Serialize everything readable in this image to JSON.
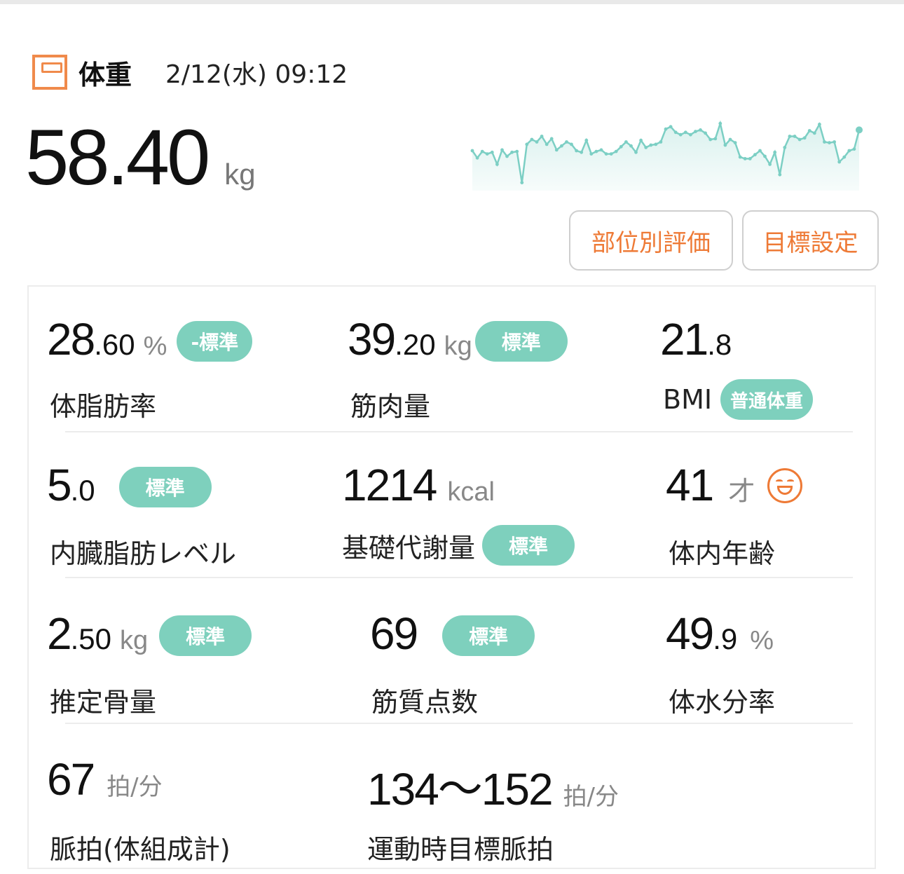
{
  "header": {
    "title": "体重",
    "datetime": "2/12(水) 09:12"
  },
  "weight": {
    "value_int": "58",
    "value_dec": ".40",
    "unit": "kg"
  },
  "sparkline": [
    50,
    41,
    49,
    46,
    48,
    33,
    51,
    43,
    48,
    49,
    10,
    58,
    64,
    61,
    68,
    58,
    65,
    51,
    56,
    61,
    58,
    50,
    48,
    63,
    46,
    49,
    51,
    46,
    46,
    49,
    55,
    61,
    56,
    48,
    63,
    54,
    57,
    58,
    61,
    77,
    80,
    73,
    70,
    73,
    70,
    74,
    76,
    72,
    64,
    65,
    84,
    57,
    64,
    60,
    42,
    40,
    40,
    45,
    50,
    43,
    33,
    48,
    20,
    54,
    68,
    68,
    64,
    66,
    75,
    72,
    83,
    61,
    60,
    61,
    36,
    42,
    50,
    52,
    76
  ],
  "buttons": {
    "part_eval": "部位別評価",
    "goal_setting": "目標設定"
  },
  "metrics": {
    "body_fat": {
      "int": "28",
      "dec": ".60",
      "unit": "%",
      "badge": "-標準",
      "label": "体脂肪率"
    },
    "muscle": {
      "int": "39",
      "dec": ".20",
      "unit": "kg",
      "badge": "標準",
      "label": "筋肉量"
    },
    "bmi": {
      "int": "21",
      "dec": ".8",
      "label": "BMI",
      "badge": "普通体重"
    },
    "visceral": {
      "int": "5",
      "dec": ".0",
      "badge": "標準",
      "label": "内臓脂肪レベル"
    },
    "bmr": {
      "int": "1214",
      "unit": "kcal",
      "label": "基礎代謝量",
      "badge": "標準"
    },
    "body_age": {
      "int": "41",
      "unit": "才",
      "label": "体内年齢"
    },
    "bone": {
      "int": "2",
      "dec": ".50",
      "unit": "kg",
      "badge": "標準",
      "label": "推定骨量"
    },
    "muscle_score": {
      "int": "69",
      "badge": "標準",
      "label": "筋質点数"
    },
    "water": {
      "int": "49",
      "dec": ".9",
      "unit": "%",
      "label": "体水分率"
    },
    "pulse": {
      "int": "67",
      "unit": "拍/分",
      "label": "脈拍(体組成計)"
    },
    "target_pulse": {
      "int": "134〜152",
      "unit": "拍/分",
      "label": "運動時目標脈拍"
    }
  },
  "colors": {
    "accent": "#ee7a36",
    "badge": "#7ed0bd",
    "chart_line": "#7ccfc4"
  },
  "icons": {
    "scale": "scale-icon",
    "face": "smile-face-icon"
  }
}
